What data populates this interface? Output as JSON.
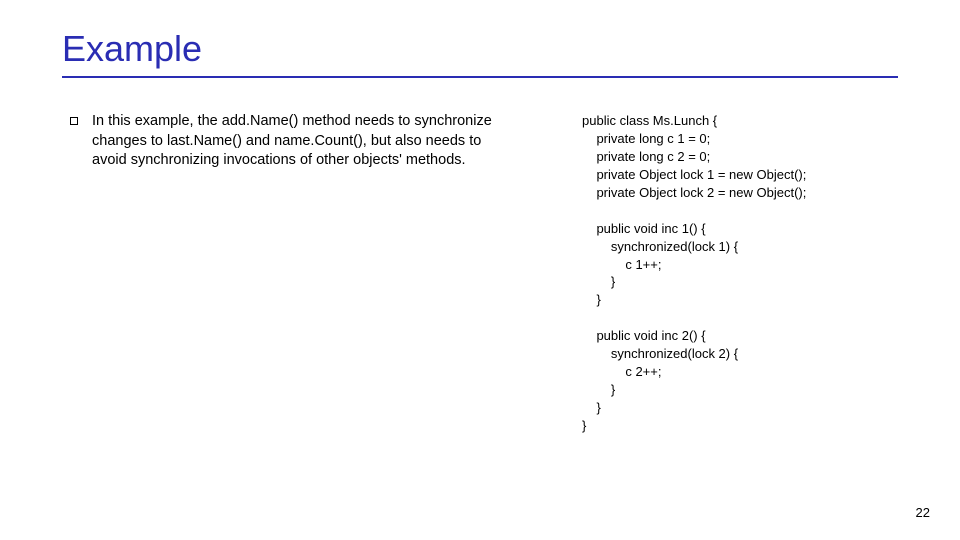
{
  "title": "Example",
  "bullet_text": "In this example, the add.Name() method needs to synchronize changes to last.Name() and name.Count(), but also needs to avoid synchronizing invocations of other objects' methods.",
  "code": "public class Ms.Lunch {\n    private long c 1 = 0;\n    private long c 2 = 0;\n    private Object lock 1 = new Object();\n    private Object lock 2 = new Object();\n\n    public void inc 1() {\n        synchronized(lock 1) {\n            c 1++;\n        }\n    }\n\n    public void inc 2() {\n        synchronized(lock 2) {\n            c 2++;\n        }\n    }\n}",
  "page_number": "22"
}
